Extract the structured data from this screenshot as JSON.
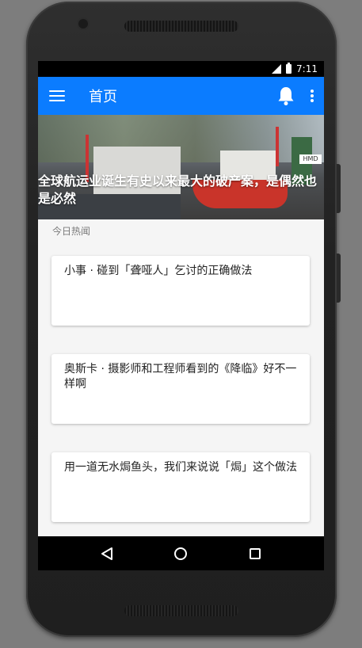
{
  "status_bar": {
    "time": "7:11",
    "network_icon": "lte-signal-icon",
    "battery_icon": "battery-icon"
  },
  "app_bar": {
    "title": "首页",
    "menu_icon": "hamburger-menu-icon",
    "notification_icon": "bell-icon",
    "overflow_icon": "more-vert-icon",
    "background_color": "#0b7cff"
  },
  "banner": {
    "headline": "全球航运业诞生有史以来最大的破产案，是偶然也是必然",
    "image_desc": "shipyard-photo"
  },
  "section": {
    "label": "今日热闻"
  },
  "news_items": [
    {
      "title": "小事 · 碰到「聋哑人」乞讨的正确做法"
    },
    {
      "title": "奥斯卡 · 摄影师和工程师看到的《降临》好不一样啊"
    },
    {
      "title": "用一道无水焗鱼头，我们来说说「焗」这个做法"
    }
  ],
  "nav_bar": {
    "back_icon": "back-triangle-icon",
    "home_icon": "home-circle-icon",
    "recents_icon": "recents-square-icon"
  }
}
